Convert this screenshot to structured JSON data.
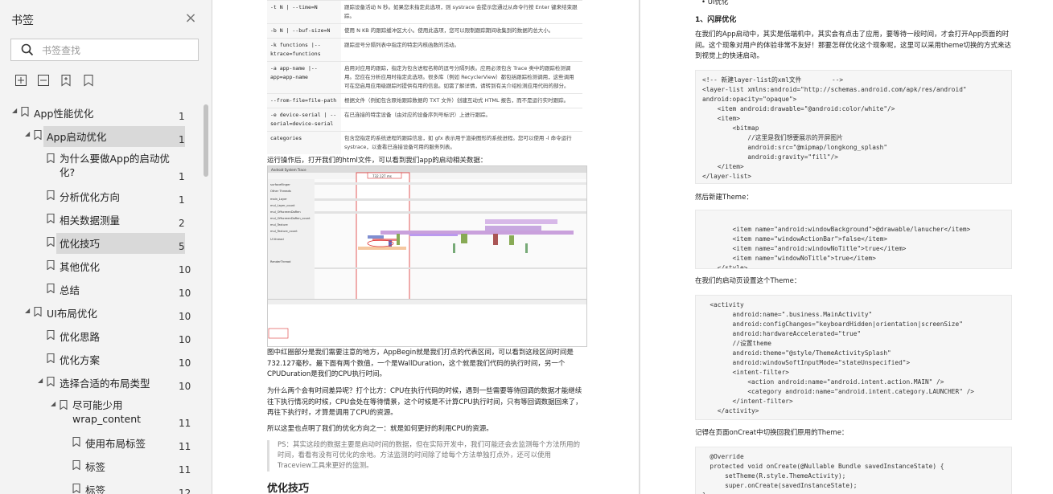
{
  "sidebar": {
    "title": "书签",
    "search_placeholder": "书签查找",
    "bookmarks": [
      {
        "label": "App性能优化",
        "page": "1",
        "level": 0,
        "expanded": true
      },
      {
        "label": "App启动优化",
        "page": "1",
        "level": 1,
        "expanded": true,
        "selected": true
      },
      {
        "label": "为什么要做App的启动优化?",
        "page": "1",
        "level": 2
      },
      {
        "label": "分析优化方向",
        "page": "1",
        "level": 2
      },
      {
        "label": "相关数据测量",
        "page": "2",
        "level": 2
      },
      {
        "label": "优化技巧",
        "page": "5",
        "level": 2,
        "selected": true
      },
      {
        "label": "其他优化",
        "page": "10",
        "level": 2
      },
      {
        "label": "总结",
        "page": "10",
        "level": 2
      },
      {
        "label": "UI布局优化",
        "page": "10",
        "level": 1,
        "expanded": true
      },
      {
        "label": "优化思路",
        "page": "10",
        "level": 2
      },
      {
        "label": "优化方案",
        "page": "10",
        "level": 2
      },
      {
        "label": "选择合适的布局类型",
        "page": "10",
        "level": 2,
        "expanded": true
      },
      {
        "label": "尽可能少用 wrap_content",
        "page": "11",
        "level": 3,
        "expanded": true
      },
      {
        "label": "使用布局标签",
        "page": "11",
        "level": 4
      },
      {
        "label": "标签",
        "page": "11",
        "level": 4
      },
      {
        "label": "标签",
        "page": "12",
        "level": 4
      }
    ]
  },
  "page1": {
    "options": [
      {
        "opt": "-t N | --time=N",
        "desc": "跟踪设备活动 N 秒。如果您未指定此选项，则 systrace 会提示您通过从命令行按 Enter 键来结束跟踪。"
      },
      {
        "opt": "-b N | --buf-size=N",
        "desc": "使用 N KB 的跟踪缓冲区大小。使用此选项，您可以限制跟踪期间收集到的数据的总大小。"
      },
      {
        "opt": "-k functions |--ktrace=functions",
        "desc": "跟踪逗号分隔列表中指定的特定内核函数的活动。"
      },
      {
        "opt": "-a app-name |--app=app-name",
        "desc": "启用对应用的跟踪，指定为包含进程名称的逗号分隔列表。应用必须包含 Trace 类中的跟踪检测调用。您应在分析应用时指定此选项。很多库（例如 RecyclerView）都包括跟踪检测调用，这些调用可在您启用应用级跟踪时提供有用的信息。如需了解详情，请转到有关介绍检测应用代码的部分。"
      },
      {
        "opt": "--from-file=file-path",
        "desc": "根据文件（例如包含原始跟踪数据的 TXT 文件）创建互动式 HTML 报告，而不是运行实时跟踪。"
      },
      {
        "opt": "-e device-serial | --serial=device-serial",
        "desc": "在已连接的特定设备（由对应的设备序列号标识）上进行跟踪。"
      },
      {
        "opt": "categories",
        "desc": "包含您指定的系统进程的跟踪信息，如 gfx 表示用于渲染图形的系统进程。您可以使用 -l 命令运行 systrace，以查看已连接设备可用的服务列表。"
      }
    ],
    "intro": "运行操作后，打开我们的html文件，可以看到我们app的启动相关数据：",
    "trace_title": "Android System Trace",
    "trace_range": "732.127 ms",
    "trace_rows": [
      "surfaceflinger",
      "Other Threads",
      "main_Layer",
      "mul_Layer_count",
      "mul_OffscreenDoRen",
      "mul_OffscreenDoRen_count",
      "mul_Texture",
      "mul_Texture_count",
      "UI thread",
      "RenderThread"
    ],
    "analysis": "图中红圈部分是我们需要注意的地方，AppBegin就是我们打点的代表区间，可以看到这段区间时间是732.127毫秒。最下面有两个数值，一个是WallDuration，这个就是我们代码的执行时间，另一个CPUDuration是我们的CPU执行时间。",
    "question": "为什么两个会有时间差异呢？打个比方：CPU在执行代码的时候，遇到一些需要等待回调的数据才能继续往下执行情况的时候，CPU会处在等待情景，这个时候是不计算CPU执行时间，只有等回调数据回来了，再往下执行时，才算是调用了CPU的资源。",
    "conclusion": "所以这里也点明了我们的优化方向之一：就是如何更好的利用CPU的资源。",
    "ps": "PS：其实这段的数据主要是启动时间的数据，但在实际开发中，我们可能还会去监测每个方法所用的时间，看看有没有可优化的余地。方法监测的时间除了给每个方法单独打点外，还可以使用Traceview工具来更好的监测。",
    "heading": "优化技巧"
  },
  "page2": {
    "bullet": "UI优化",
    "section": "1、闪屏优化",
    "para1": "在我们的App启动中，其实是低端机中，其实会有点击了应用，要等待一段时间，才会打开App页面的时间。这个现象对用户的体验非常不友好！那要怎样优化这个现象呢，这里可以采用theme切换的方式来达到视觉上的快速启动。",
    "code1": "<!-- 新建layer-list的xml文件        -->\n<layer-list xmlns:android=\"http://schemas.android.com/apk/res/android\"\nandroid:opacity=\"opaque\">\n    <item android:drawable=\"@android:color/white\"/>\n    <item>\n        <bitmap\n            //这里是我们想要展示的开屏图片\n            android:src=\"@mipmap/longkong_splash\"\n            android:gravity=\"fill\"/>\n    </item>\n</layer-list>",
    "para2": "然后新建Theme：",
    "code2": "\n        <item name=\"android:windowBackground\">@drawable/lanucher</item>\n        <item name=\"windowActionBar\">false</item>\n        <item name=\"android:windowNoTitle\">true</item>\n        <item name=\"windowNoTitle\">true</item>\n    </style>",
    "para3": "在我们的启动页设置这个Theme：",
    "code3": "  <activity\n        android:name=\".business.MainActivity\"\n        android:configChanges=\"keyboardHidden|orientation|screenSize\"\n        android:hardwareAccelerated=\"true\"\n        //设置theme\n        android:theme=\"@style/ThemeActivitySplash\"\n        android:windowSoftInputMode=\"stateUnspecified\">\n        <intent-filter>\n            <action android:name=\"android.intent.action.MAIN\" />\n            <category android:name=\"android.intent.category.LAUNCHER\" />\n        </intent-filter>\n    </activity>",
    "para4": "记得在页面onCreat中切换回我们原用的Theme：",
    "code4": "  @Override\n  protected void onCreate(@Nullable Bundle savedInstanceState) {\n      setTheme(R.style.ThemeActivity);\n      super.onCreate(savedInstanceState);\n}"
  }
}
